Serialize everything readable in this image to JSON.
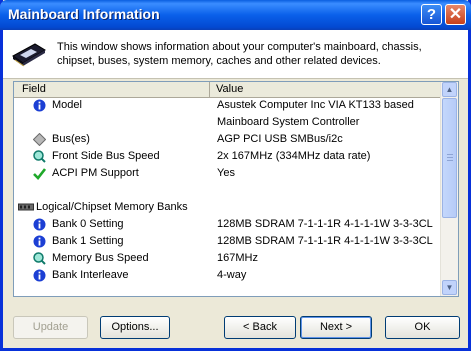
{
  "window": {
    "title": "Mainboard Information",
    "help_glyph": "?",
    "close_glyph": "✕",
    "description": "This window shows information about your computer's mainboard, chassis, chipset, buses, system memory, caches and other related devices."
  },
  "grid": {
    "columns": [
      "Field",
      "Value"
    ],
    "rows": [
      {
        "field": "Model",
        "value": "Asustek Computer Inc VIA KT133 based",
        "icon": "info-icon"
      },
      {
        "field": "",
        "value": "Mainboard System Controller",
        "icon": ""
      },
      {
        "field": "Bus(es)",
        "value": "AGP PCI USB SMBus/i2c",
        "icon": "bus-icon"
      },
      {
        "field": "Front Side Bus Speed",
        "value": "2x 167MHz (334MHz data rate)",
        "icon": "speed-icon"
      },
      {
        "field": "ACPI PM Support",
        "value": "Yes",
        "icon": "checkmark-icon"
      },
      {
        "field": "",
        "value": "",
        "icon": ""
      },
      {
        "field": "Logical/Chipset Memory Banks",
        "value": "",
        "icon": "memory-icon"
      },
      {
        "field": "Bank 0 Setting",
        "value": "128MB SDRAM 7-1-1-1R 4-1-1-1W 3-3-3CL",
        "icon": "info-icon"
      },
      {
        "field": "Bank 1 Setting",
        "value": "128MB SDRAM 7-1-1-1R 4-1-1-1W 3-3-3CL",
        "icon": "info-icon"
      },
      {
        "field": "Memory Bus Speed",
        "value": "167MHz",
        "icon": "speed-icon"
      },
      {
        "field": "Bank Interleave",
        "value": "4-way",
        "icon": "info-icon"
      }
    ],
    "scroll_up_glyph": "▲",
    "scroll_down_glyph": "▼"
  },
  "buttons": {
    "update": "Update",
    "options": "Options...",
    "back": "< Back",
    "next": "Next >",
    "ok": "OK"
  }
}
